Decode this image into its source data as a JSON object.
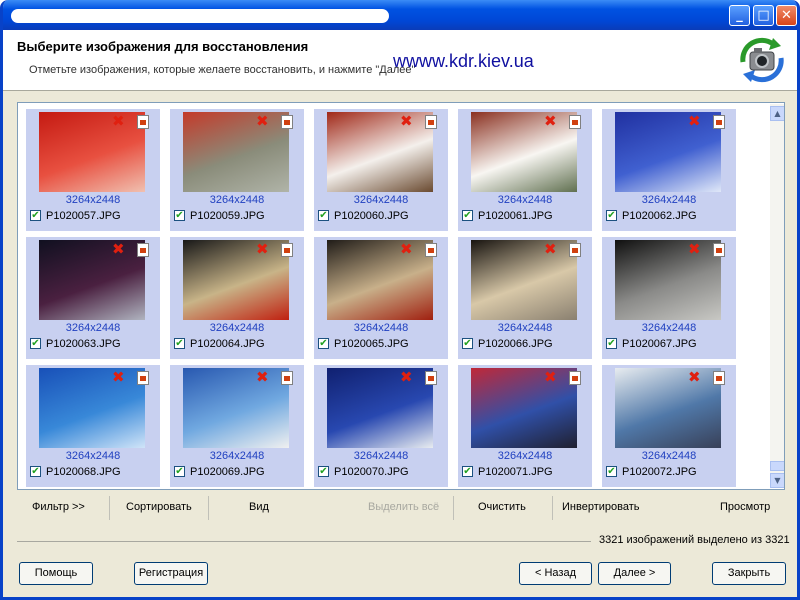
{
  "header": {
    "title": "Выберите изображения для восстановления",
    "subtitle": "Отметьте изображения, которые желаете восстановить, и нажмите \"Далее\"",
    "watermark": "wwww.kdr.kiev.ua"
  },
  "window_buttons": {
    "minimize": "_",
    "maximize": "□",
    "close": "✕"
  },
  "images": [
    {
      "resolution": "3264x2448",
      "filename": "P1020057.JPG",
      "checked": true,
      "palette": [
        "#c41a12",
        "#e85040",
        "#f0c0b0"
      ]
    },
    {
      "resolution": "3264x2448",
      "filename": "P1020059.JPG",
      "checked": true,
      "palette": [
        "#c43a2a",
        "#8a8c7a",
        "#b0b4a8"
      ]
    },
    {
      "resolution": "3264x2448",
      "filename": "P1020060.JPG",
      "checked": true,
      "palette": [
        "#a02818",
        "#f4f0ec",
        "#6a4a30"
      ]
    },
    {
      "resolution": "3264x2448",
      "filename": "P1020061.JPG",
      "checked": true,
      "palette": [
        "#8a3020",
        "#f8f6f2",
        "#607050"
      ]
    },
    {
      "resolution": "3264x2448",
      "filename": "P1020062.JPG",
      "checked": true,
      "palette": [
        "#2030a0",
        "#4060d0",
        "#e0e8f8"
      ]
    },
    {
      "resolution": "3264x2448",
      "filename": "P1020063.JPG",
      "checked": true,
      "palette": [
        "#101020",
        "#4a2040",
        "#b0b4c0"
      ]
    },
    {
      "resolution": "3264x2448",
      "filename": "P1020064.JPG",
      "checked": true,
      "palette": [
        "#181818",
        "#c8b488",
        "#c02010"
      ]
    },
    {
      "resolution": "3264x2448",
      "filename": "P1020065.JPG",
      "checked": true,
      "palette": [
        "#201c18",
        "#c8b08a",
        "#a02010"
      ]
    },
    {
      "resolution": "3264x2448",
      "filename": "P1020066.JPG",
      "checked": true,
      "palette": [
        "#181410",
        "#d8c8a8",
        "#8a8070"
      ]
    },
    {
      "resolution": "3264x2448",
      "filename": "P1020067.JPG",
      "checked": true,
      "palette": [
        "#101010",
        "#8a8a88",
        "#c8c8c4"
      ]
    },
    {
      "resolution": "3264x2448",
      "filename": "P1020068.JPG",
      "checked": true,
      "palette": [
        "#1850b8",
        "#3888d8",
        "#d0e4f8"
      ]
    },
    {
      "resolution": "3264x2448",
      "filename": "P1020069.JPG",
      "checked": true,
      "palette": [
        "#2858b0",
        "#70a8e0",
        "#f0f0f0"
      ]
    },
    {
      "resolution": "3264x2448",
      "filename": "P1020070.JPG",
      "checked": true,
      "palette": [
        "#102070",
        "#2848b0",
        "#e8ecf0"
      ]
    },
    {
      "resolution": "3264x2448",
      "filename": "P1020071.JPG",
      "checked": true,
      "palette": [
        "#c02838",
        "#3050a8",
        "#202030"
      ]
    },
    {
      "resolution": "3264x2448",
      "filename": "P1020072.JPG",
      "checked": true,
      "palette": [
        "#e8ecf0",
        "#5078a8",
        "#384058"
      ]
    }
  ],
  "toolbar": {
    "filter": "Фильтр >>",
    "sort": "Сортировать",
    "view": "Вид",
    "select_all": "Выделить всё",
    "clear": "Очистить",
    "invert": "Инвертировать",
    "preview": "Просмотр"
  },
  "status": "3321 изображений выделено из 3321",
  "buttons": {
    "help": "Помощь",
    "register": "Регистрация",
    "back": "< Назад",
    "next": "Далее >",
    "close": "Закрыть"
  },
  "colors": {
    "titlebar": "#0054e3",
    "panel": "#ece9d8",
    "thumb_background": "#c8d0f0",
    "resolution_text": "#2040c0"
  }
}
